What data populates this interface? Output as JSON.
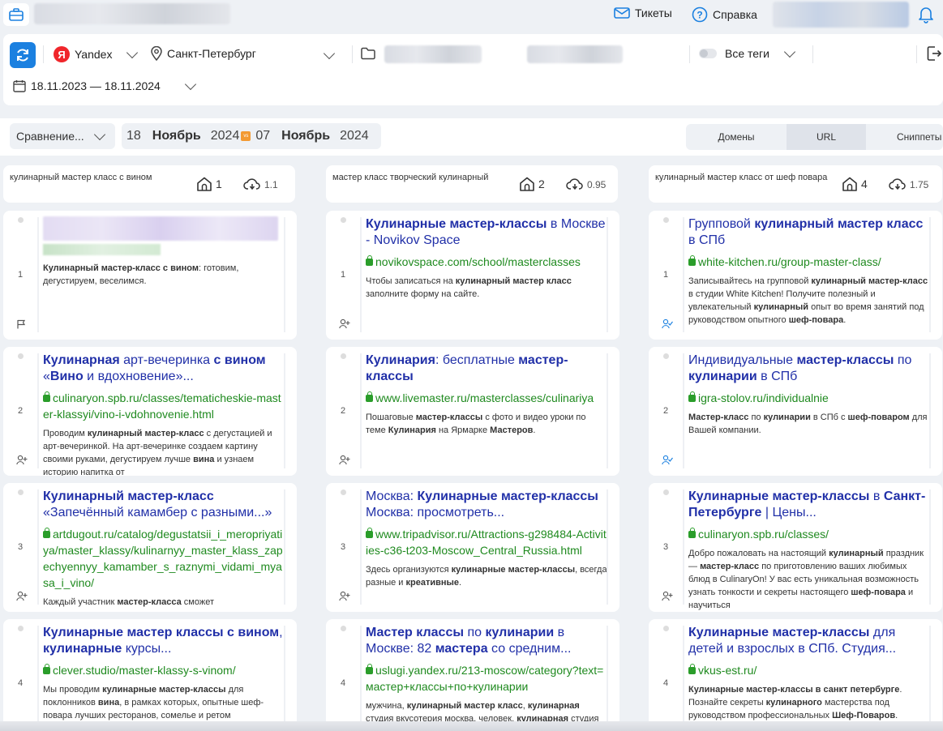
{
  "topbar": {
    "tickets_label": "Тикеты",
    "help_label": "Справка"
  },
  "filters": {
    "engine": "Yandex",
    "region": "Санкт-Петербург",
    "tags": "Все теги",
    "date_range": "18.11.2023 — 18.11.2024"
  },
  "compare": {
    "mode": "Сравнение...",
    "date1_day": "18",
    "date1_month": "Ноябрь",
    "date1_year": "2024",
    "vs_label": "vs",
    "date2_day": "07",
    "date2_month": "Ноябрь",
    "date2_year": "2024"
  },
  "view_tabs": [
    "Домены",
    "URL",
    "Сниппеты"
  ],
  "active_tab": "URL",
  "queries": [
    {
      "text": "кулинарный мастер класс с вином",
      "count": "1",
      "freq": "1.1"
    },
    {
      "text": "мастер класс творческий кулинарный",
      "count": "2",
      "freq": "0.95"
    },
    {
      "text": "кулинарный мастер класс от шеф повара",
      "count": "4",
      "freq": "1.75"
    }
  ],
  "results": [
    [
      {
        "pos": "1",
        "title": "",
        "url": "",
        "snippet": "<b>Кулинарный мастер-класс с вином</b>: готовим, дегустируем, веселимся.",
        "blurred": true,
        "icon": "flag-icon"
      },
      {
        "pos": "2",
        "title": "<b>Кулинарная</b> арт-вечеринка <b>с вином</b> «<b>Вино</b> и вдохновение»...",
        "url": "culinaryon.spb.ru/classes/tematicheskie-master-klassyi/vino-i-vdohnovenie.html",
        "snippet": "Проводим <b>кулинарный мастер-класс</b> с дегустацией и арт-вечеринкой. На арт-вечеринке создаем картину своими руками, дегустируем лучше <b>вина</b> и узнаем историю напитка от",
        "icon": "add-user-icon"
      },
      {
        "pos": "3",
        "title": "<b>Кулинарный мастер-класс</b> «Запечённый камамбер с разными...»",
        "url": "artdugout.ru/catalog/degustatsii_i_meropriyatiya/master_klassy/kulinarnyy_master_klass_zapechyennyy_kamamber_s_raznymi_vidami_myasa_i_vino/",
        "snippet": "Каждый участник <b>мастер-класса</b> сможет",
        "icon": "add-user-icon"
      },
      {
        "pos": "4",
        "title": "<b>Кулинарные мастер классы с вином</b>, <b>кулинарные</b> курсы...",
        "url": "clever.studio/master-klassy-s-vinom/",
        "snippet": "Мы проводим <b>кулинарные мастер-классы</b> для поклонников <b>вина</b>, в рамках которых, опытные шеф-повара лучших ресторанов, сомелье и ретом правильного выбора.",
        "icon": "add-user-icon"
      }
    ],
    [
      {
        "pos": "1",
        "title": "<b>Кулинарные мастер-классы</b> в Москве - Novikov Space",
        "url": "novikovspace.com/school/masterclasses",
        "snippet": "Чтобы записаться на <b>кулинарный мастер класс</b> заполните форму на сайте.",
        "icon": "add-user-icon"
      },
      {
        "pos": "2",
        "title": "<b>Кулинария</b>: бесплатные <b>мастер-классы</b>",
        "url": "www.livemaster.ru/masterclasses/culinariya",
        "snippet": "Пошаговые <b>мастер-классы</b> с фото и видео уроки по теме <b>Кулинария</b> на Ярмарке <b>Мастеров</b>.",
        "icon": "add-user-icon"
      },
      {
        "pos": "3",
        "title": "Москва: <b>Кулинарные мастер-классы</b> Москва: просмотреть...",
        "url": "www.tripadvisor.ru/Attractions-g298484-Activities-c36-t203-Moscow_Central_Russia.html",
        "snippet": "Здесь организуются <b>кулинарные мастер-классы</b>, всегда разные и <b>креативные</b>.",
        "icon": "add-user-icon"
      },
      {
        "pos": "4",
        "title": "<b>Мастер классы</b> по <b>кулинарии</b> в Москве: 82 <b>мастера</b> со средним...",
        "url": "uslugi.yandex.ru/213-moscow/category?text=мастер+классы+по+кулинарии",
        "snippet": "мужчина, <b>кулинарный мастер класс</b>, <b>кулинарная</b> студия вкусотерия москва, человек, <b>кулинарная</b> студия вкусотерия",
        "icon": "add-user-icon"
      }
    ],
    [
      {
        "pos": "1",
        "title": "Групповой <b>кулинарный мастер класс</b> в СПб",
        "url": "white-kitchen.ru/group-master-class/",
        "snippet": "Записывайтесь на групповой <b>кулинарный мастер-класс</b> в студии White Kitchen! Получите полезный и увлекательный <b>кулинарный</b> опыт во время занятий под руководством опытного <b>шеф-повара</b>.",
        "icon": "user-check-icon"
      },
      {
        "pos": "2",
        "title": "Индивидуальные <b>мастер-классы</b> по <b>кулинарии</b> в СПб",
        "url": "igra-stolov.ru/individualnie",
        "snippet": "<b>Мастер-класс</b> по <b>кулинарии</b> в СПб с <b>шеф-поваром</b> для Вашей компании.",
        "icon": "user-check-icon"
      },
      {
        "pos": "3",
        "title": "<b>Кулинарные мастер-классы</b> в <b>Санкт-Петербурге</b> | Цены...",
        "url": "culinaryon.spb.ru/classes/",
        "snippet": "Добро пожаловать на настоящий <b>кулинарный</b> праздник — <b>мастер-класс</b> по приготовлению ваших любимых блюд в CulinaryOn! У вас есть уникальная возможность узнать тонкости и секреты настоящего <b>шеф-повара</b> и научиться",
        "icon": "add-user-icon"
      },
      {
        "pos": "4",
        "title": "<b>Кулинарные мастер-классы</b> для детей и взрослых в СПб. Студия...",
        "url": "vkus-est.ru/",
        "snippet": "<b>Кулинарные мастер-классы в санкт петербурге</b>. Познайте секреты <b>кулинарного</b> мастерства под руководством профессиональных <b>Шеф-Поваров</b>.",
        "icon": "add-user-icon"
      }
    ]
  ]
}
